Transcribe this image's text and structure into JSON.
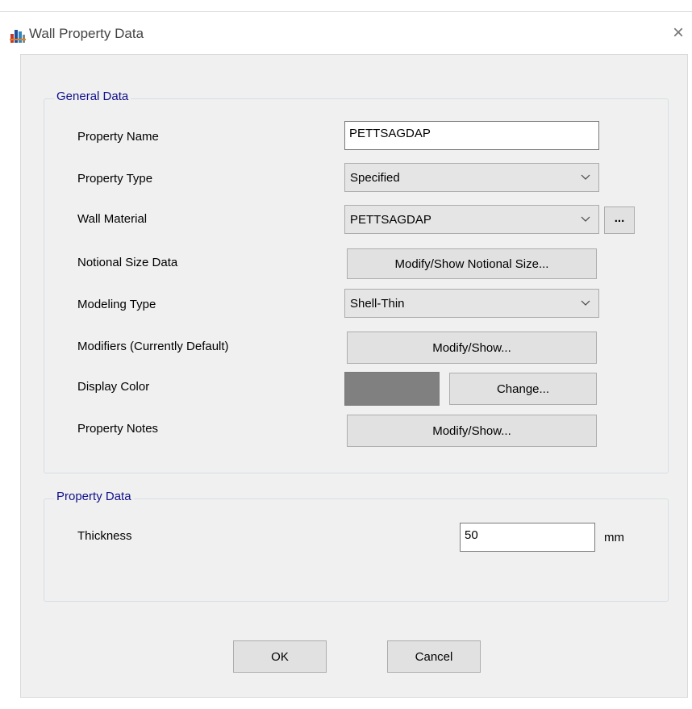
{
  "window": {
    "title": "Wall Property Data",
    "close_glyph": "×",
    "icon": "wall-property-app-icon"
  },
  "general_data": {
    "legend": "General Data",
    "property_name": {
      "label": "Property Name",
      "value": "PETTSAGDAP"
    },
    "property_type": {
      "label": "Property Type",
      "value": "Specified"
    },
    "wall_material": {
      "label": "Wall Material",
      "value": "PETTSAGDAP",
      "browse_label": "..."
    },
    "notional_size": {
      "label": "Notional Size Data",
      "button": "Modify/Show Notional Size..."
    },
    "modeling_type": {
      "label": "Modeling Type",
      "value": "Shell-Thin"
    },
    "modifiers": {
      "label": "Modifiers (Currently Default)",
      "button": "Modify/Show..."
    },
    "display_color": {
      "label": "Display Color",
      "color": "#808080",
      "button": "Change..."
    },
    "property_notes": {
      "label": "Property Notes",
      "button": "Modify/Show..."
    }
  },
  "property_data": {
    "legend": "Property Data",
    "thickness": {
      "label": "Thickness",
      "value": "50",
      "unit": "mm"
    }
  },
  "footer": {
    "ok_label": "OK",
    "cancel_label": "Cancel"
  }
}
